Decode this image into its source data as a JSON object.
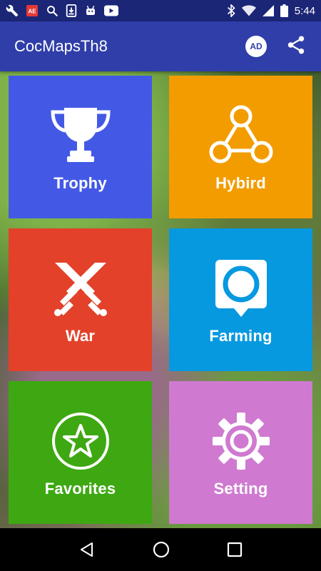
{
  "status_bar": {
    "time": "5:44",
    "left_icons": [
      "wrench-icon",
      "app-notification-icon",
      "search-icon",
      "download-icon",
      "android-icon",
      "youtube-icon"
    ],
    "right_icons": [
      "bluetooth-icon",
      "wifi-icon",
      "signal-icon",
      "battery-icon"
    ]
  },
  "app_bar": {
    "title": "CocMapsTh8",
    "ad_label": "AD"
  },
  "tiles": [
    {
      "label": "Trophy",
      "color": "#4359e6",
      "icon": "trophy-icon"
    },
    {
      "label": "Hybird",
      "color": "#f39c00",
      "icon": "hybrid-network-icon"
    },
    {
      "label": "War",
      "color": "#e3412a",
      "icon": "crossed-swords-icon"
    },
    {
      "label": "Farming",
      "color": "#0799e0",
      "icon": "map-pin-icon"
    },
    {
      "label": "Favorites",
      "color": "#3ea812",
      "icon": "star-icon"
    },
    {
      "label": "Setting",
      "color": "#cf7ad0",
      "icon": "gear-icon"
    }
  ],
  "nav_bar": {
    "buttons": [
      "back-icon",
      "home-icon",
      "recents-icon"
    ]
  }
}
